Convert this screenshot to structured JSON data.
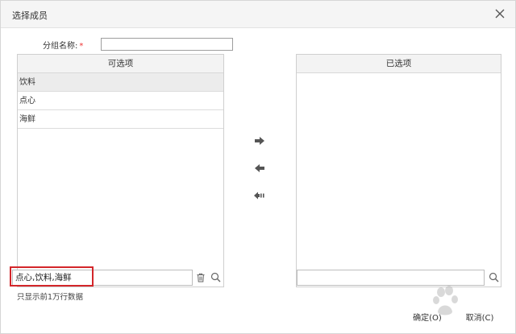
{
  "dialog": {
    "title": "选择成员",
    "close_icon": "close-icon"
  },
  "form": {
    "group_name_label": "分组名称:",
    "required_mark": "*",
    "group_name_value": ""
  },
  "available": {
    "header": "可选项",
    "items": [
      "饮料",
      "点心",
      "海鲜"
    ],
    "search_value": "点心,饮料,海鲜",
    "note": "只显示前1万行数据"
  },
  "selected": {
    "header": "已选项",
    "search_value": ""
  },
  "actions": {
    "move_right_icon": "arrow-right-icon",
    "move_left_icon": "arrow-left-icon",
    "move_all_left_icon": "arrow-left-all-icon"
  },
  "buttons": {
    "ok": "确定(O)",
    "cancel": "取消(C)"
  },
  "colors": {
    "highlight_border": "#d3262a",
    "required": "#e33333"
  }
}
